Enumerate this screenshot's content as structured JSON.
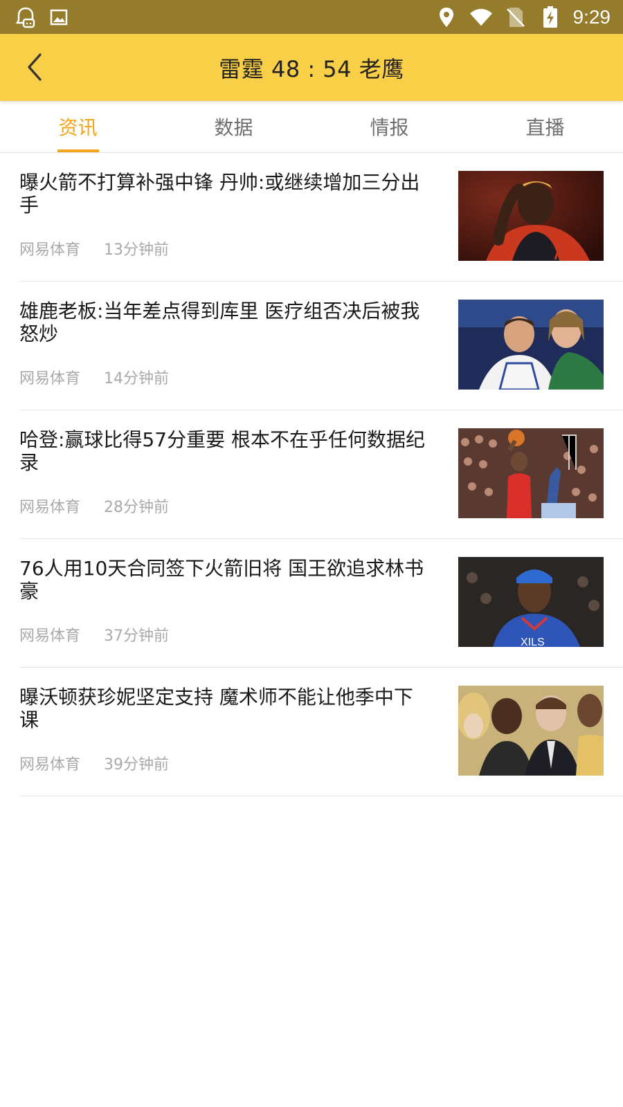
{
  "status_bar": {
    "time": "9:29",
    "icons": [
      "assistant-icon",
      "image-icon",
      "location-icon",
      "wifi-icon",
      "no-sim-icon",
      "battery-charging-icon"
    ],
    "bg_color": "#957b2c"
  },
  "header": {
    "title": "雷霆 48 : 54 老鹰",
    "back_icon": "chevron-left-icon",
    "bg_color": "#f8cf46"
  },
  "tabs": [
    {
      "label": "资讯",
      "active": true
    },
    {
      "label": "数据",
      "active": false
    },
    {
      "label": "情报",
      "active": false
    },
    {
      "label": "直播",
      "active": false
    }
  ],
  "accent_color": "#f2a51b",
  "news": [
    {
      "title": "曝火箭不打算补强中锋 丹帅:或继续增加三分出手",
      "source": "网易体育",
      "time": "13分钟前"
    },
    {
      "title": "雄鹿老板:当年差点得到库里 医疗组否决后被我怒炒",
      "source": "网易体育",
      "time": "14分钟前"
    },
    {
      "title": "哈登:赢球比得57分重要 根本不在乎任何数据纪录",
      "source": "网易体育",
      "time": "28分钟前"
    },
    {
      "title": "76人用10天合同签下火箭旧将 国王欲追求林书豪",
      "source": "网易体育",
      "time": "37分钟前"
    },
    {
      "title": "曝沃顿获珍妮坚定支持 魔术师不能让他季中下课",
      "source": "网易体育",
      "time": "39分钟前"
    }
  ]
}
